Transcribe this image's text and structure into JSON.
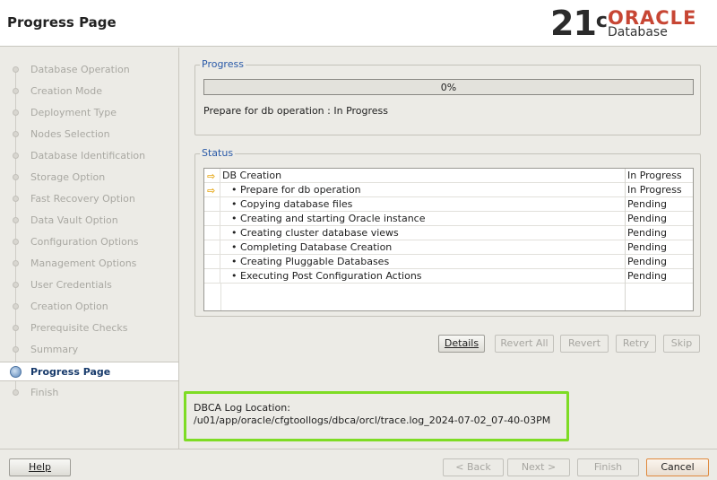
{
  "header": {
    "title": "Progress Page",
    "logo": {
      "version": "21",
      "version_sup": "c",
      "brand": "ORACLE",
      "product": "Database"
    }
  },
  "sidebar": {
    "steps": [
      {
        "label": "Database Operation"
      },
      {
        "label": "Creation Mode"
      },
      {
        "label": "Deployment Type"
      },
      {
        "label": "Nodes Selection"
      },
      {
        "label": "Database Identification"
      },
      {
        "label": "Storage Option"
      },
      {
        "label": "Fast Recovery Option"
      },
      {
        "label": "Data Vault Option"
      },
      {
        "label": "Configuration Options"
      },
      {
        "label": "Management Options"
      },
      {
        "label": "User Credentials"
      },
      {
        "label": "Creation Option"
      },
      {
        "label": "Prerequisite Checks"
      },
      {
        "label": "Summary"
      },
      {
        "label": "Progress Page"
      },
      {
        "label": "Finish"
      }
    ],
    "current_index": 14
  },
  "progress": {
    "group_title": "Progress",
    "percent": 0,
    "percent_text": "0%",
    "message": "Prepare for db operation : In Progress"
  },
  "status": {
    "group_title": "Status",
    "rows": [
      {
        "name": "DB Creation",
        "status": "In Progress",
        "level": 0,
        "arrow": true
      },
      {
        "name": "Prepare for db operation",
        "status": "In Progress",
        "level": 1,
        "arrow": true
      },
      {
        "name": "Copying database files",
        "status": "Pending",
        "level": 1,
        "arrow": false
      },
      {
        "name": "Creating and starting Oracle instance",
        "status": "Pending",
        "level": 1,
        "arrow": false
      },
      {
        "name": "Creating cluster database views",
        "status": "Pending",
        "level": 1,
        "arrow": false
      },
      {
        "name": "Completing Database Creation",
        "status": "Pending",
        "level": 1,
        "arrow": false
      },
      {
        "name": "Creating Pluggable Databases",
        "status": "Pending",
        "level": 1,
        "arrow": false
      },
      {
        "name": "Executing Post Configuration Actions",
        "status": "Pending",
        "level": 1,
        "arrow": false
      }
    ]
  },
  "actions": {
    "details": "Details",
    "revert_all": "Revert All",
    "revert": "Revert",
    "retry": "Retry",
    "skip": "Skip"
  },
  "log": {
    "label": "DBCA Log Location:",
    "path": "/u01/app/oracle/cfgtoollogs/dbca/orcl/trace.log_2024-07-02_07-40-03PM"
  },
  "footer": {
    "help": "Help",
    "back": "< Back",
    "next": "Next >",
    "finish": "Finish",
    "cancel": "Cancel"
  },
  "colors": {
    "accent_blue": "#2a5aa8",
    "highlight_green": "#7edc24",
    "arrow_yellow": "#e6a817",
    "oracle_red": "#c74634"
  }
}
